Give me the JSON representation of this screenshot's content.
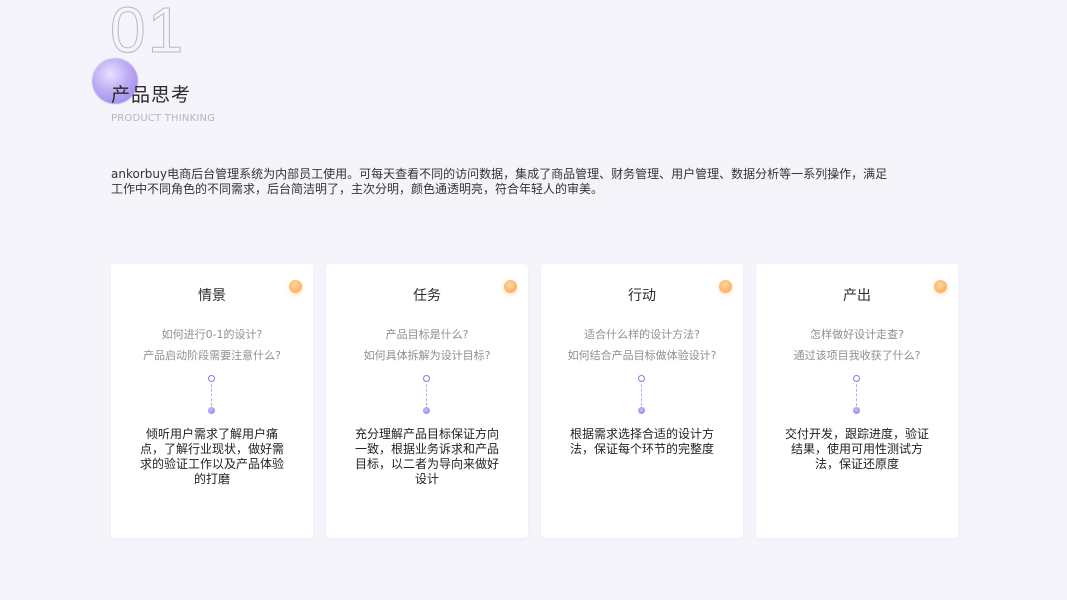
{
  "header": {
    "number": "01",
    "title": "产品思考",
    "subtitle": "PRODUCT THINKING"
  },
  "intro": {
    "line1": "ankorbuy电商后台管理系统为内部员工使用。可每天查看不同的访问数据，集成了商品管理、财务管理、用户管理、数据分析等一系列操作，满足",
    "line2": "工作中不同角色的不同需求，后台简洁明了，主次分明，颜色通透明亮，符合年轻人的审美。"
  },
  "colors": {
    "accent_purple": "#8e76ea",
    "accent_orange": "#ffb86a",
    "background": "#f5f4fb"
  },
  "cards": [
    {
      "title": "情景",
      "q1": "如何进行0-1的设计?",
      "q2": "产品启动阶段需要注意什么?",
      "body": "倾听用户需求了解用户痛点，了解行业现状，做好需求的验证工作以及产品体验的打磨"
    },
    {
      "title": "任务",
      "q1": "产品目标是什么?",
      "q2": "如何具体拆解为设计目标?",
      "body": "充分理解产品目标保证方向一致，根据业务诉求和产品目标，以二者为导向来做好设计"
    },
    {
      "title": "行动",
      "q1": "适合什么样的设计方法?",
      "q2": "如何结合产品目标做体验设计?",
      "body": "根据需求选择合适的设计方法，保证每个环节的完整度"
    },
    {
      "title": "产出",
      "q1": "怎样做好设计走查?",
      "q2": "通过该项目我收获了什么?",
      "body": "交付开发，跟踪进度，验证结果，使用可用性测试方法，保证还原度"
    }
  ]
}
